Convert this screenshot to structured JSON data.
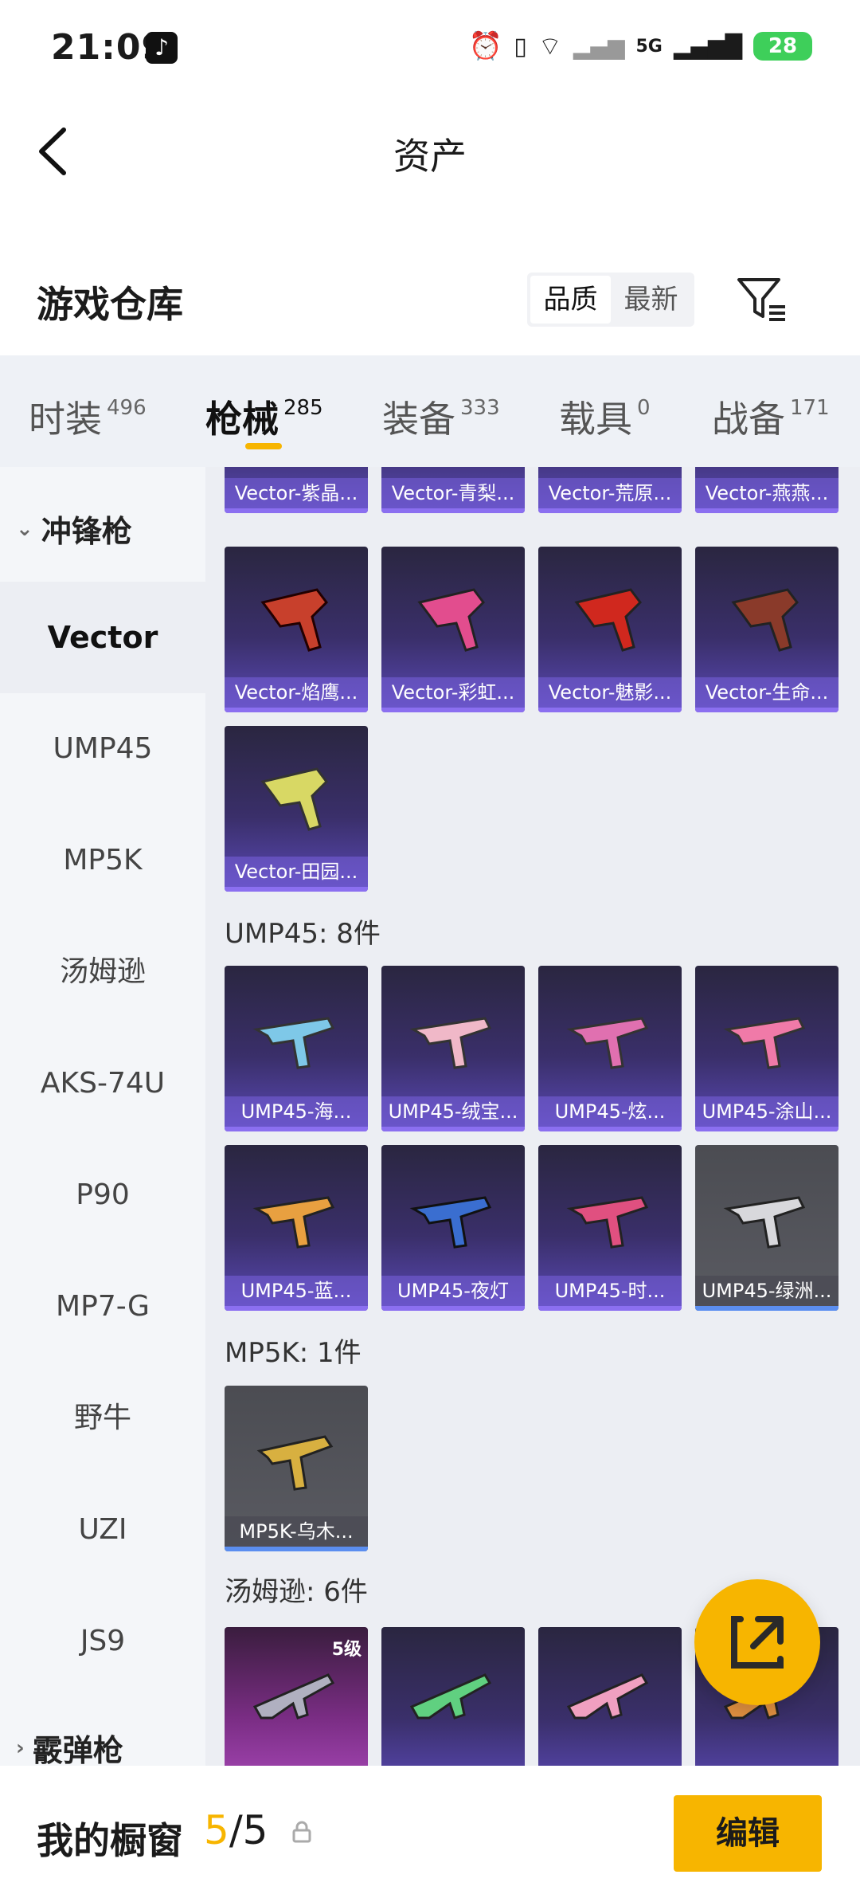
{
  "status_bar": {
    "time": "21:09",
    "network": "5G",
    "battery": "28"
  },
  "header": {
    "title": "资产"
  },
  "warehouse": {
    "title": "游戏仓库",
    "sort_options": [
      "品质",
      "最新"
    ],
    "active_sort": "品质"
  },
  "tabs": [
    {
      "label": "时装",
      "count": "496"
    },
    {
      "label": "枪械",
      "count": "285"
    },
    {
      "label": "装备",
      "count": "333"
    },
    {
      "label": "载具",
      "count": "0"
    },
    {
      "label": "战备",
      "count": "171"
    }
  ],
  "sidebar": {
    "category_open": "冲锋枪",
    "items": [
      "Vector",
      "UMP45",
      "MP5K",
      "汤姆逊",
      "AKS-74U",
      "P90",
      "MP7-G",
      "野牛",
      "UZI",
      "JS9"
    ],
    "category_next": "霰弹枪"
  },
  "content": {
    "vector_top_row": [
      "Vector-紫晶...",
      "Vector-青梨...",
      "Vector-荒原...",
      "Vector-燕燕..."
    ],
    "vector_row2": [
      "Vector-焰鹰...",
      "Vector-彩虹...",
      "Vector-魅影...",
      "Vector-生命..."
    ],
    "vector_row3": [
      "Vector-田园..."
    ],
    "ump_title": "UMP45: 8件",
    "ump_row1": [
      "UMP45-海...",
      "UMP45-绒宝...",
      "UMP45-炫...",
      "UMP45-涂山..."
    ],
    "ump_row2": [
      "UMP45-蓝...",
      "UMP45-夜灯",
      "UMP45-时...",
      "UMP45-绿洲..."
    ],
    "mp5k_title": "MP5K: 1件",
    "mp5k_row": [
      "MP5K-乌木..."
    ],
    "thompson_title": "汤姆逊: 6件",
    "thompson_level": "5级"
  },
  "bottom": {
    "title": "我的橱窗",
    "count_current": "5",
    "count_total": "/5",
    "edit_label": "编辑"
  },
  "colors": {
    "accent": "#f7b500",
    "card_purple": "#3a2f6a"
  }
}
